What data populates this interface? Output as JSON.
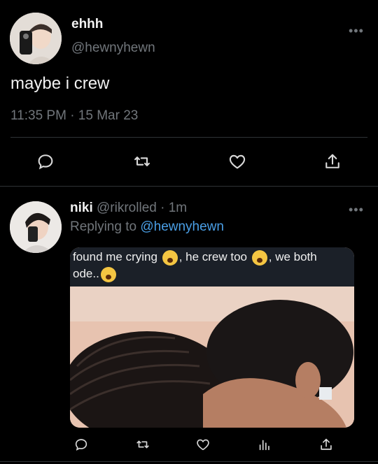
{
  "main_tweet": {
    "display_name": "ehhh",
    "handle": "@hewnyhewn",
    "text": "maybe i crew",
    "timestamp": "11:35 PM · 15 Mar 23"
  },
  "reply": {
    "display_name": "niki",
    "handle": "@rikrolled",
    "time": "· 1m",
    "replying_prefix": "Replying to",
    "replying_to": "@hewnyhewn",
    "media_caption_line1_a": "found me crying",
    "media_caption_line1_b": ", he crew too",
    "media_caption_line1_c": ", we both",
    "media_caption_line2": "ode.."
  },
  "icons": {
    "more": "more-icon",
    "reply": "reply-icon",
    "retweet": "retweet-icon",
    "like": "heart-icon",
    "share": "share-icon",
    "analytics": "analytics-icon"
  },
  "colors": {
    "background": "#000000",
    "text": "#e7e9ea",
    "muted": "#71767b",
    "link": "#4a9fe6",
    "divider": "#2f3336"
  }
}
